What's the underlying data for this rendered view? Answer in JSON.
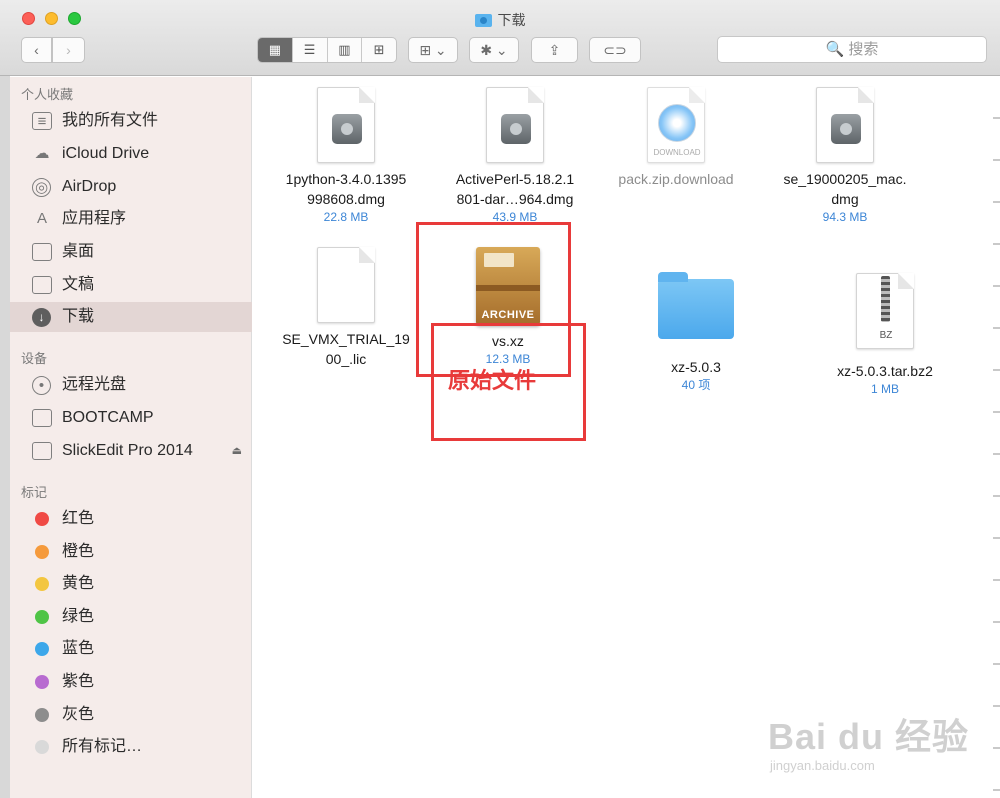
{
  "window": {
    "title": "下载"
  },
  "toolbar": {
    "back_glyph": "‹",
    "forward_glyph": "›",
    "view_modes": [
      "▦",
      "☰",
      "▥",
      "⊞"
    ],
    "arrange_glyph": "⊞ ⌄",
    "action_glyph": "✱ ⌄",
    "share_glyph": "⇪",
    "tag_glyph": "⊂⊃",
    "search_placeholder": "🔍 搜索"
  },
  "sidebar": {
    "favorites_header": "个人收藏",
    "favorites": [
      {
        "label": "我的所有文件",
        "icon": "all-files-icon"
      },
      {
        "label": "iCloud Drive",
        "icon": "cloud-icon"
      },
      {
        "label": "AirDrop",
        "icon": "airdrop-icon"
      },
      {
        "label": "应用程序",
        "icon": "applications-icon"
      },
      {
        "label": "桌面",
        "icon": "desktop-icon"
      },
      {
        "label": "文稿",
        "icon": "documents-icon"
      },
      {
        "label": "下载",
        "icon": "download-icon",
        "selected": true
      }
    ],
    "devices_header": "设备",
    "devices": [
      {
        "label": "远程光盘",
        "icon": "disc-icon"
      },
      {
        "label": "BOOTCAMP",
        "icon": "drive-icon"
      },
      {
        "label": "SlickEdit Pro 2014",
        "icon": "drive-icon",
        "eject": "⏏"
      }
    ],
    "tags_header": "标记",
    "tags": [
      {
        "label": "红色",
        "color": "#f04a45"
      },
      {
        "label": "橙色",
        "color": "#f59a3c"
      },
      {
        "label": "黄色",
        "color": "#f3c640"
      },
      {
        "label": "绿色",
        "color": "#4fc446"
      },
      {
        "label": "蓝色",
        "color": "#3ca7ea"
      },
      {
        "label": "紫色",
        "color": "#b86bd0"
      },
      {
        "label": "灰色",
        "color": "#8d8d8d"
      },
      {
        "label": "所有标记…",
        "color": "#d9d9d9"
      }
    ]
  },
  "files": [
    {
      "name": "1python-3.4.0.1395\n998608.dmg",
      "sub": "22.8 MB",
      "kind": "dmg"
    },
    {
      "name": "ActivePerl-5.18.2.1\n801-dar…964.dmg",
      "sub": "43.9 MB",
      "kind": "dmg"
    },
    {
      "name": "pack.zip.download",
      "sub": "",
      "kind": "download",
      "icon_label": "DOWNLOAD"
    },
    {
      "name": "se_19000205_mac.\ndmg",
      "sub": "94.3 MB",
      "kind": "dmg"
    },
    {
      "name": "SE_VMX_TRIAL_19\n00_.lic",
      "sub": "",
      "kind": "doc"
    },
    {
      "name": "vs.xz",
      "sub": "12.3 MB",
      "kind": "archive",
      "icon_label": "ARCHIVE"
    },
    {
      "name": "xz-5.0.3",
      "sub": "40 项",
      "kind": "folder"
    },
    {
      "name": "xz-5.0.3.tar.bz2",
      "sub": "1 MB",
      "kind": "bz2",
      "icon_label": "BZ"
    }
  ],
  "annotation": {
    "text": "原始文件",
    "color": "#e83a3a"
  },
  "watermark": {
    "line1": "Bai du 经验",
    "line2": "jingyan.baidu.com"
  }
}
